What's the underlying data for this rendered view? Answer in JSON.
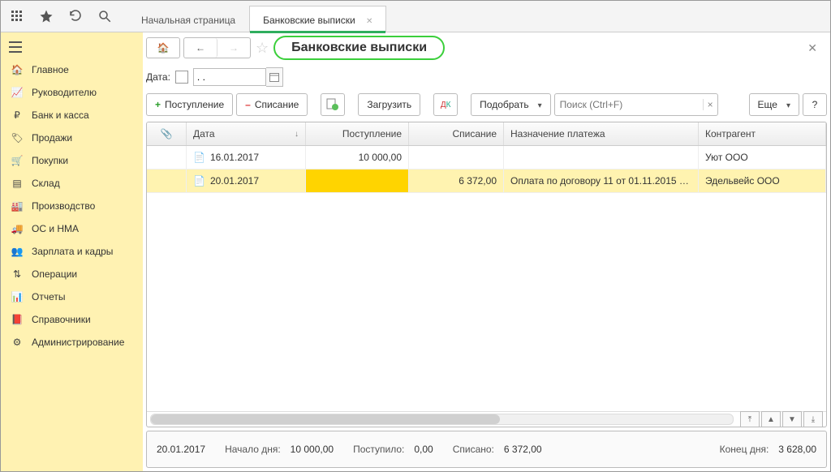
{
  "topbar": {
    "tabs": [
      {
        "label": "Начальная страница",
        "active": false
      },
      {
        "label": "Банковские выписки",
        "active": true
      }
    ]
  },
  "sidebar": {
    "items": [
      {
        "label": "Главное",
        "icon": "home"
      },
      {
        "label": "Руководителю",
        "icon": "chart"
      },
      {
        "label": "Банк и касса",
        "icon": "ruble"
      },
      {
        "label": "Продажи",
        "icon": "tag"
      },
      {
        "label": "Покупки",
        "icon": "cart"
      },
      {
        "label": "Склад",
        "icon": "boxes"
      },
      {
        "label": "Производство",
        "icon": "factory"
      },
      {
        "label": "ОС и НМА",
        "icon": "truck"
      },
      {
        "label": "Зарплата и кадры",
        "icon": "people"
      },
      {
        "label": "Операции",
        "icon": "ops"
      },
      {
        "label": "Отчеты",
        "icon": "bars"
      },
      {
        "label": "Справочники",
        "icon": "book"
      },
      {
        "label": "Администрирование",
        "icon": "gear"
      }
    ]
  },
  "page": {
    "title": "Банковские выписки",
    "dateLabel": "Дата:",
    "dateValue": ". .",
    "toolbar": {
      "inflow": "Поступление",
      "outflow": "Списание",
      "load": "Загрузить",
      "pick": "Подобрать",
      "searchPlaceholder": "Поиск (Ctrl+F)",
      "more": "Еще"
    },
    "columns": {
      "attach": "",
      "date": "Дата",
      "inflow": "Поступление",
      "outflow": "Списание",
      "purpose": "Назначение платежа",
      "party": "Контрагент"
    },
    "rows": [
      {
        "date": "16.01.2017",
        "in": "10 000,00",
        "out": "",
        "purpose": "",
        "party": "Уют ООО",
        "selected": false
      },
      {
        "date": "20.01.2017",
        "in": "",
        "out": "6 372,00",
        "purpose": "Оплата по договору 11 от 01.11.2015 …",
        "party": "Эдельвейс ООО",
        "selected": true
      }
    ],
    "footer": {
      "date": "20.01.2017",
      "startLabel": "Начало дня:",
      "startValue": "10 000,00",
      "inLabel": "Поступило:",
      "inValue": "0,00",
      "outLabel": "Списано:",
      "outValue": "6 372,00",
      "endLabel": "Конец дня:",
      "endValue": "3 628,00"
    }
  }
}
